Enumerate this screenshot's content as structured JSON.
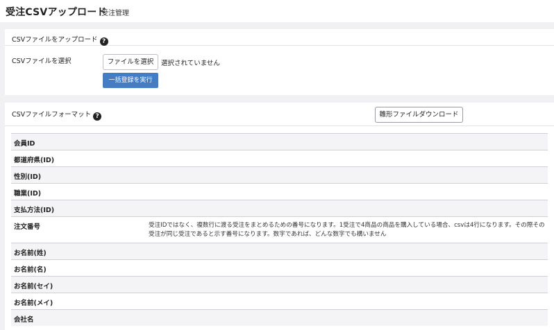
{
  "header": {
    "title": "受注CSVアップロード",
    "subtitle": "受注管理"
  },
  "upload_card": {
    "title": "CSVファイルをアップロード",
    "file_label": "CSVファイルを選択",
    "file_button_label": "ファイルを選択",
    "file_status": "選択されていません",
    "submit_label": "一括登録を実行"
  },
  "format_card": {
    "title": "CSVファイルフォーマット",
    "download_label": "雛形ファイルダウンロード",
    "rows": [
      {
        "label": "会員ID",
        "description": ""
      },
      {
        "label": "都道府県(ID)",
        "description": ""
      },
      {
        "label": "性別(ID)",
        "description": ""
      },
      {
        "label": "職業(ID)",
        "description": ""
      },
      {
        "label": "支払方法(ID)",
        "description": ""
      },
      {
        "label": "注文番号",
        "description": "受注IDではなく、複数行に渡る受注をまとめるための番号になります。1受注で4商品の商品を購入している場合、csvは4行になります。その際その受注が同じ受注であると示す番号になります。数字であれば、どんな数字でも構いません"
      },
      {
        "label": "お名前(姓)",
        "description": ""
      },
      {
        "label": "お名前(名)",
        "description": ""
      },
      {
        "label": "お名前(セイ)",
        "description": ""
      },
      {
        "label": "お名前(メイ)",
        "description": ""
      },
      {
        "label": "会社名",
        "description": ""
      }
    ]
  }
}
